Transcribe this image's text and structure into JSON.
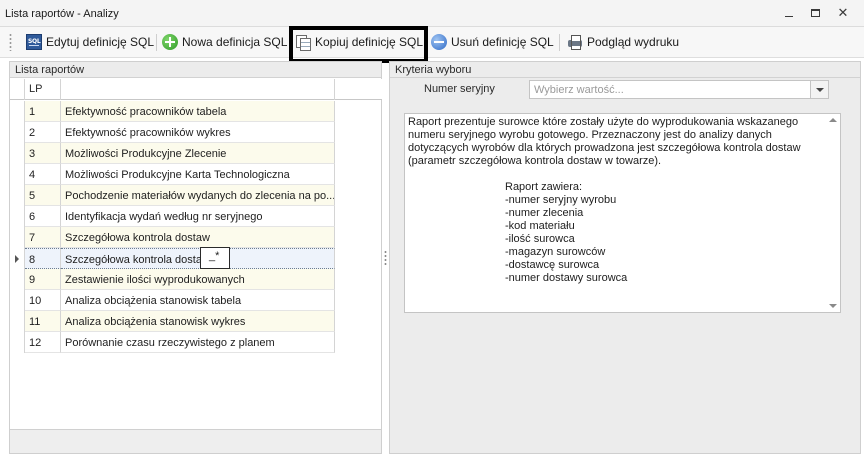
{
  "window": {
    "title": "Lista raportów - Analizy",
    "minimize_glyph": "",
    "maximize_glyph": "",
    "close_glyph": "✕"
  },
  "toolbar": {
    "edit_sql": "Edytuj definicję SQL",
    "new_sql": "Nowa definicja SQL",
    "copy_sql": "Kopiuj definicję SQL",
    "delete_sql": "Usuń definicję SQL",
    "print_preview": "Podgląd wydruku"
  },
  "left": {
    "header": "Lista raportów",
    "col_lp": "LP",
    "col_name": "",
    "rows": [
      {
        "lp": "1",
        "name": "Efektywność pracowników tabela"
      },
      {
        "lp": "2",
        "name": "Efektywność pracowników wykres"
      },
      {
        "lp": "3",
        "name": "Możliwości Produkcyjne Zlecenie"
      },
      {
        "lp": "4",
        "name": "Możliwości Produkcyjne Karta Technologiczna"
      },
      {
        "lp": "5",
        "name": "Pochodzenie materiałów wydanych do zlecenia na po..."
      },
      {
        "lp": "6",
        "name": "Identyfikacja wydań według nr seryjnego"
      },
      {
        "lp": "7",
        "name": "Szczegółowa kontrola dostaw"
      },
      {
        "lp": "8",
        "name": "Szczegółowa kontrola dostaw"
      },
      {
        "lp": "9",
        "name": "Zestawienie ilości wyprodukowanych"
      },
      {
        "lp": "10",
        "name": "Analiza obciążenia stanowisk tabela"
      },
      {
        "lp": "11",
        "name": "Analiza obciążenia stanowisk wykres"
      },
      {
        "lp": "12",
        "name": "Porównanie czasu rzeczywistego z planem"
      }
    ],
    "edit_value": "_*"
  },
  "right": {
    "header": "Kryteria wyboru",
    "serial_label": "Numer seryjny",
    "serial_placeholder": "Wybierz wartość...",
    "description": "Raport prezentuje surowce które zostały użyte do wyprodukowania wskazanego numeru seryjnego wyrobu gotowego. Przeznaczony jest do analizy danych dotyczących wyrobów dla których prowadzona jest szczegółowa kontrola dostaw (parametr szczegółowa kontrola dostaw w towarze).",
    "contents_lines": [
      "Raport zawiera:",
      "-numer seryjny wyrobu",
      "-numer zlecenia",
      "-kod materiału",
      "-ilość surowca",
      "-magazyn surowców",
      "-dostawcę surowca",
      "-numer dostawy surowca"
    ]
  }
}
